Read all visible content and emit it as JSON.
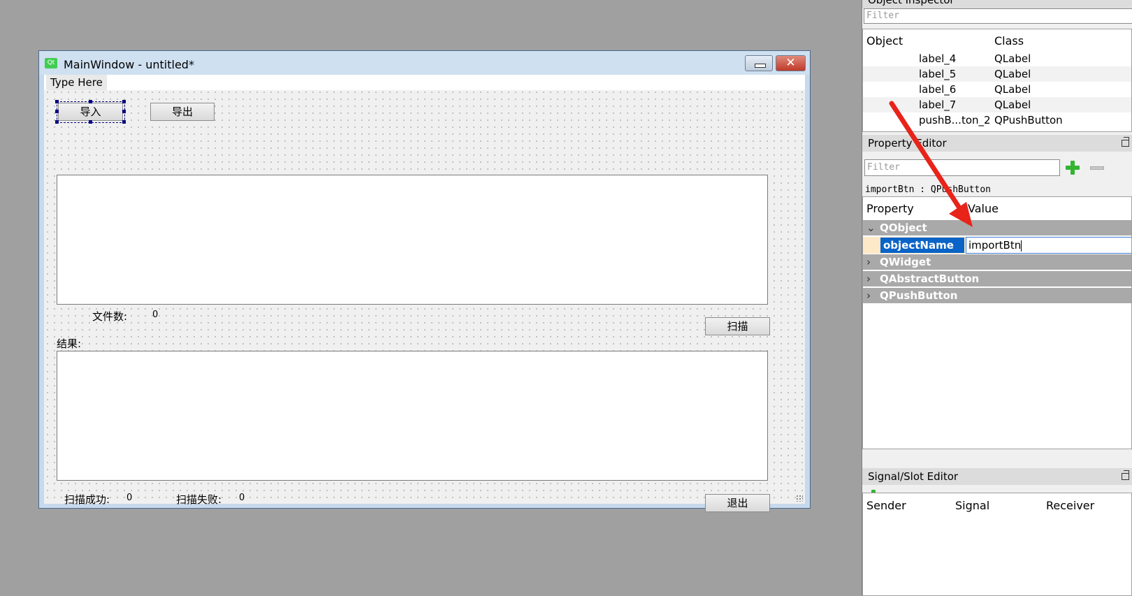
{
  "window": {
    "app_icon_text": "Qt",
    "title": "MainWindow - untitled*",
    "menubar_placeholder": "Type Here"
  },
  "form": {
    "import_button": "导入",
    "export_button": "导出",
    "file_count_label": "文件数:",
    "file_count_value": "0",
    "scan_button": "扫描",
    "result_label": "结果:",
    "scan_success_label": "扫描成功:",
    "scan_success_value": "0",
    "scan_fail_label": "扫描失败:",
    "scan_fail_value": "0",
    "exit_button": "退出"
  },
  "object_inspector": {
    "title": "Object Inspector",
    "filter_placeholder": "Filter",
    "col_object": "Object",
    "col_class": "Class",
    "rows": [
      {
        "object": "label_4",
        "class": "QLabel"
      },
      {
        "object": "label_5",
        "class": "QLabel"
      },
      {
        "object": "label_6",
        "class": "QLabel"
      },
      {
        "object": "label_7",
        "class": "QLabel"
      },
      {
        "object": "pushB...ton_2",
        "class": "QPushButton"
      }
    ]
  },
  "property_editor": {
    "title": "Property Editor",
    "filter_placeholder": "Filter",
    "class_line": "importBtn : QPushButton",
    "col_property": "Property",
    "col_value": "Value",
    "groups": [
      "QObject",
      "QWidget",
      "QAbstractButton",
      "QPushButton"
    ],
    "property_name": "objectName",
    "property_value": "importBtn"
  },
  "signal_slot_editor": {
    "title": "Signal/Slot Editor",
    "col_sender": "Sender",
    "col_signal": "Signal",
    "col_receiver": "Receiver"
  },
  "colors": {
    "annotation_arrow": "#e8231a",
    "selected_property": "#0a64c8",
    "group_header": "#a9a9a9"
  }
}
